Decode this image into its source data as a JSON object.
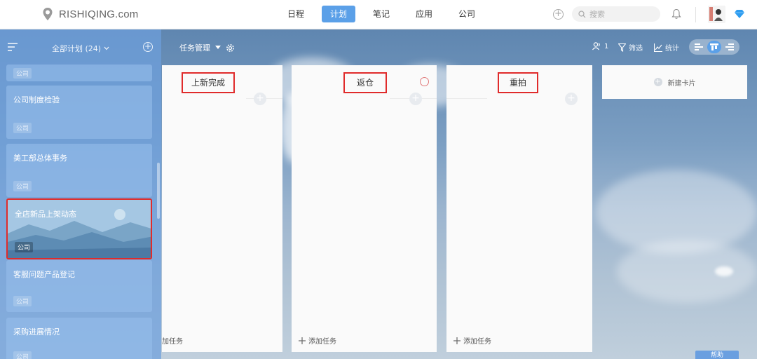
{
  "brand": {
    "name": "RISHIQING.com"
  },
  "nav": {
    "items": [
      {
        "label": "日程",
        "active": false
      },
      {
        "label": "计划",
        "active": true
      },
      {
        "label": "笔记",
        "active": false
      },
      {
        "label": "应用",
        "active": false
      },
      {
        "label": "公司",
        "active": false
      }
    ]
  },
  "search": {
    "placeholder": "搜索"
  },
  "sidebar": {
    "title": "全部计划 (24)",
    "plans": [
      {
        "name": "",
        "tag": "公司"
      },
      {
        "name": "公司制度检验",
        "tag": "公司"
      },
      {
        "name": "美工部总体事务",
        "tag": "公司"
      },
      {
        "name": "全店新品上架动态",
        "tag": "公司",
        "highlighted": true
      },
      {
        "name": "客服问题产品登记",
        "tag": "公司"
      },
      {
        "name": "采购进展情况",
        "tag": "公司"
      }
    ]
  },
  "board": {
    "title": "任务管理",
    "member_count": "1",
    "filter_label": "筛选",
    "stats_label": "统计",
    "columns": [
      {
        "title": "上新完成",
        "add_task": "加任务"
      },
      {
        "title": "返仓",
        "add_task": "添加任务"
      },
      {
        "title": "重拍",
        "add_task": "添加任务"
      }
    ],
    "new_card_label": "新建卡片"
  },
  "help": {
    "label": "帮助"
  },
  "colors": {
    "accent": "#5ba0e8",
    "highlight_border": "#e02b2b",
    "column_bg": "#fafafa"
  }
}
